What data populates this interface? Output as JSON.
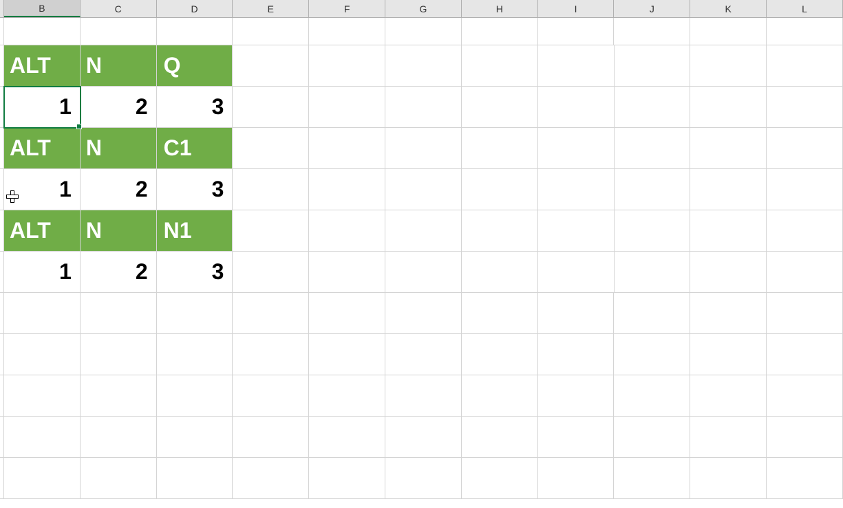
{
  "columns": [
    "B",
    "C",
    "D",
    "E",
    "F",
    "G",
    "H",
    "I",
    "J",
    "K",
    "L"
  ],
  "active_column": "B",
  "active_cell": {
    "col": "B",
    "row": 3
  },
  "blocks": [
    {
      "header": {
        "B": "ALT",
        "C": "N",
        "D": "Q"
      },
      "data": {
        "B": "1",
        "C": "2",
        "D": "3"
      },
      "header_row": 2,
      "data_row": 3
    },
    {
      "header": {
        "B": "ALT",
        "C": "N",
        "D": "C1"
      },
      "data": {
        "B": "1",
        "C": "2",
        "D": "3"
      },
      "header_row": 4,
      "data_row": 5
    },
    {
      "header": {
        "B": "ALT",
        "C": "N",
        "D": "N1"
      },
      "data": {
        "B": "1",
        "C": "2",
        "D": "3"
      },
      "header_row": 6,
      "data_row": 7
    }
  ],
  "chart_data": {
    "type": "table",
    "tables": [
      {
        "headers": [
          "ALT",
          "N",
          "Q"
        ],
        "rows": [
          [
            1,
            2,
            3
          ]
        ]
      },
      {
        "headers": [
          "ALT",
          "N",
          "C1"
        ],
        "rows": [
          [
            1,
            2,
            3
          ]
        ]
      },
      {
        "headers": [
          "ALT",
          "N",
          "N1"
        ],
        "rows": [
          [
            1,
            2,
            3
          ]
        ]
      }
    ]
  }
}
